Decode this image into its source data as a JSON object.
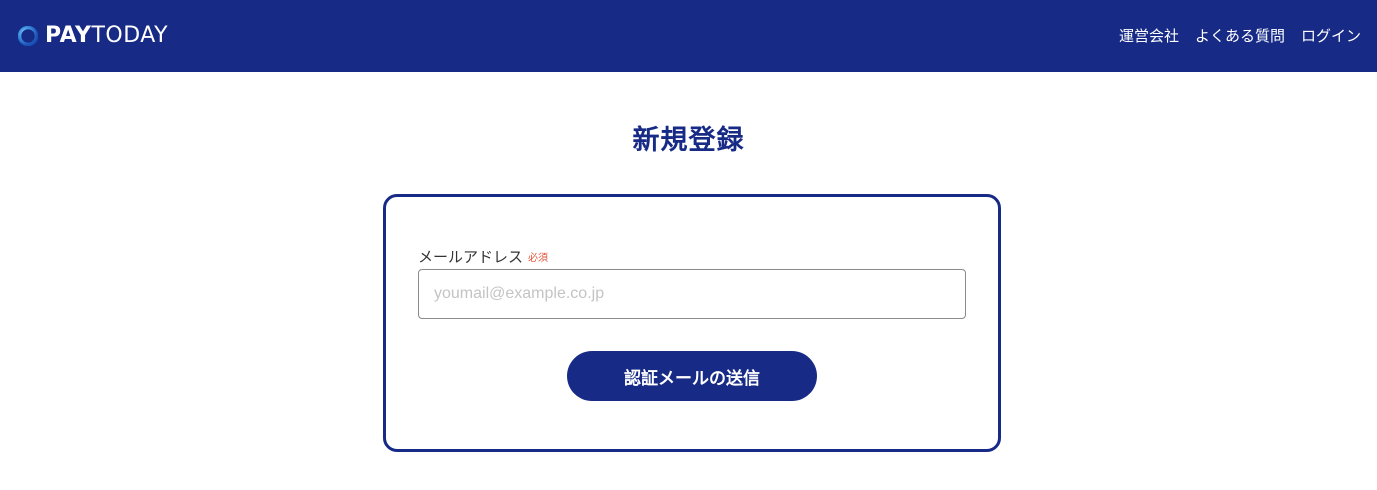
{
  "header": {
    "logo": {
      "icon": "circle-logo-icon",
      "text_pay": "PAY",
      "text_today": "TODAY"
    },
    "nav": [
      {
        "label": "運営会社"
      },
      {
        "label": "よくある質問"
      },
      {
        "label": "ログイン"
      }
    ]
  },
  "page": {
    "title": "新規登録"
  },
  "form": {
    "email": {
      "label": "メールアドレス",
      "required_badge": "必須",
      "placeholder": "youmail@example.co.jp",
      "value": ""
    },
    "submit_label": "認証メールの送信"
  },
  "colors": {
    "brand_navy": "#162a86",
    "required_red": "#e2553b",
    "placeholder_gray": "#c4c4c4",
    "background": "#ffffff"
  }
}
